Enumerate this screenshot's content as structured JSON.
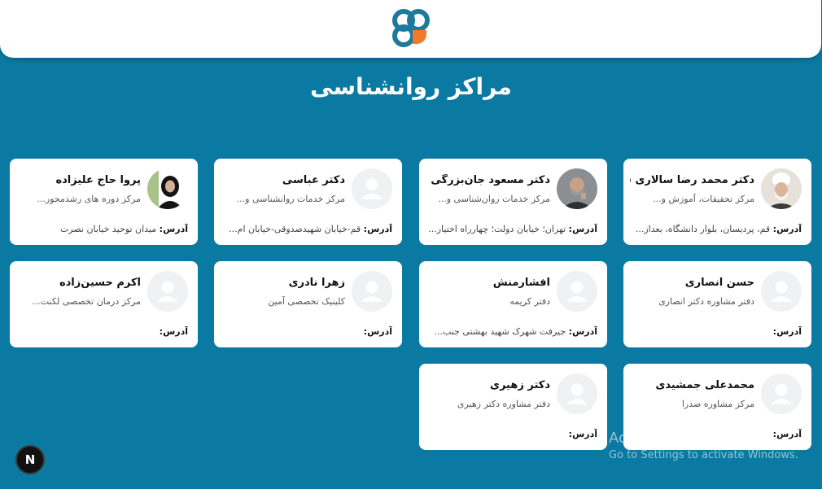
{
  "header": {
    "logo_icon": "brand-logo-icon"
  },
  "page_title": "مراکز روانشناسی",
  "address_label": "آدرس:",
  "colors": {
    "background": "#0a7aa3",
    "card": "#ffffff",
    "logo_blue": "#1d7a9c",
    "logo_orange": "#f07a2a"
  },
  "cards": [
    {
      "name": "دکتر محمد رضا سالاری فر",
      "desc": "مرکز تحقیقات، آموزش و...",
      "address": "قم، پردیسان، بلوار دانشگاه، بعداز...",
      "avatar": "photo-cleric"
    },
    {
      "name": "دکتر مسعود جان‌بزرگی",
      "desc": "مرکز خدمات روان‌شناسی و...",
      "address": "تهران؛ خیابان دولت؛ چهارراه اختیار...",
      "avatar": "photo-man"
    },
    {
      "name": "دکتر عباسی",
      "desc": "مرکز خدمات روانشناسی و...",
      "address": "قم-خیابان شهیدصدوقی-خیابان ام...",
      "avatar": "placeholder"
    },
    {
      "name": "پروا حاج علیزاده",
      "desc": "مرکز دوره های رشدمحور...",
      "address": "میدان توحید خیابان نصرت",
      "avatar": "photo-woman"
    },
    {
      "name": "حسن انصاری",
      "desc": "دفتر مشاوره دکتر انصاری",
      "address": "",
      "avatar": "placeholder"
    },
    {
      "name": "افشارمنش",
      "desc": "دفتر کریمه",
      "address": "جیرفت شهرک شهید بهشتی جنب...",
      "avatar": "placeholder"
    },
    {
      "name": "زهرا نادری",
      "desc": "کلینیک تخصصی آمین",
      "address": "",
      "avatar": "placeholder"
    },
    {
      "name": "اکرم حسین‌زاده",
      "desc": "مرکز درمان تخصصی لکنت...",
      "address": "",
      "avatar": "placeholder"
    },
    {
      "name": "محمدعلی جمشیدی",
      "desc": "مرکز مشاوره صدرا",
      "address": "",
      "avatar": "placeholder"
    },
    {
      "name": "دکتر زهیری",
      "desc": "دفتر مشاوره دکتر زهیری",
      "address": "",
      "avatar": "placeholder"
    }
  ],
  "watermark": {
    "title": "Activate Windows",
    "subtitle": "Go to Settings to activate Windows."
  },
  "next_badge": "N"
}
